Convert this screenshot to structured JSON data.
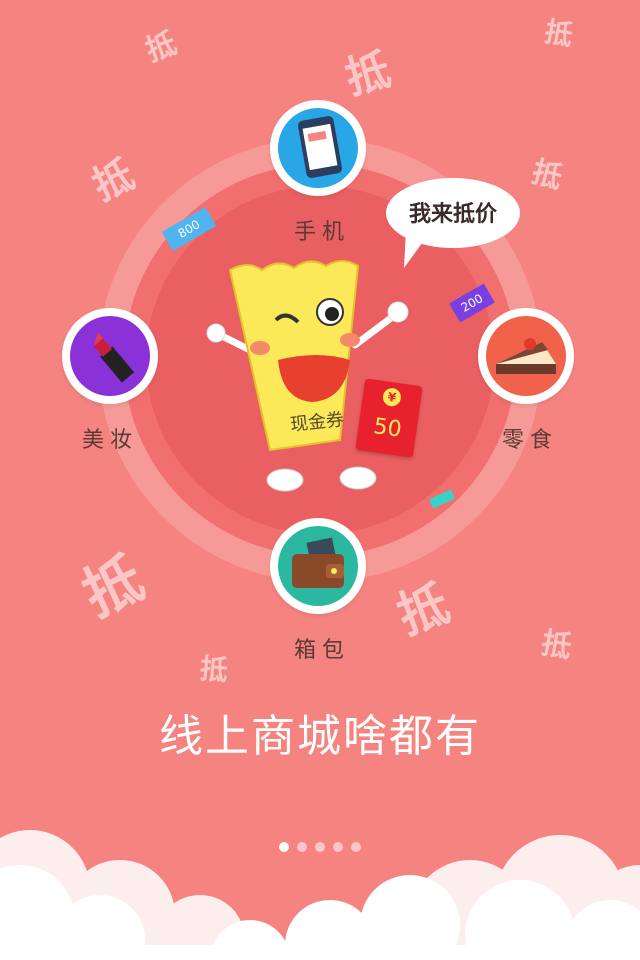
{
  "background": {
    "color": "#f58481",
    "decor_char": "抵"
  },
  "center": {
    "bubble_text": "我来抵价",
    "coupon_text": "现金券",
    "red_packet_value": "50",
    "red_packet_coin": "¥",
    "tag_top_left": "800",
    "tag_right": "200"
  },
  "categories": [
    {
      "label": "手机",
      "icon": "phone-icon"
    },
    {
      "label": "美妆",
      "icon": "lipstick-icon"
    },
    {
      "label": "零食",
      "icon": "cake-icon"
    },
    {
      "label": "箱包",
      "icon": "wallet-icon"
    }
  ],
  "headline": "线上商城啥都有",
  "pagination": {
    "count": 5,
    "active_index": 0
  },
  "colors": {
    "accent_yellow": "#fbe95a",
    "red_packet": "#e8212e",
    "cloud": "#ffffff"
  }
}
